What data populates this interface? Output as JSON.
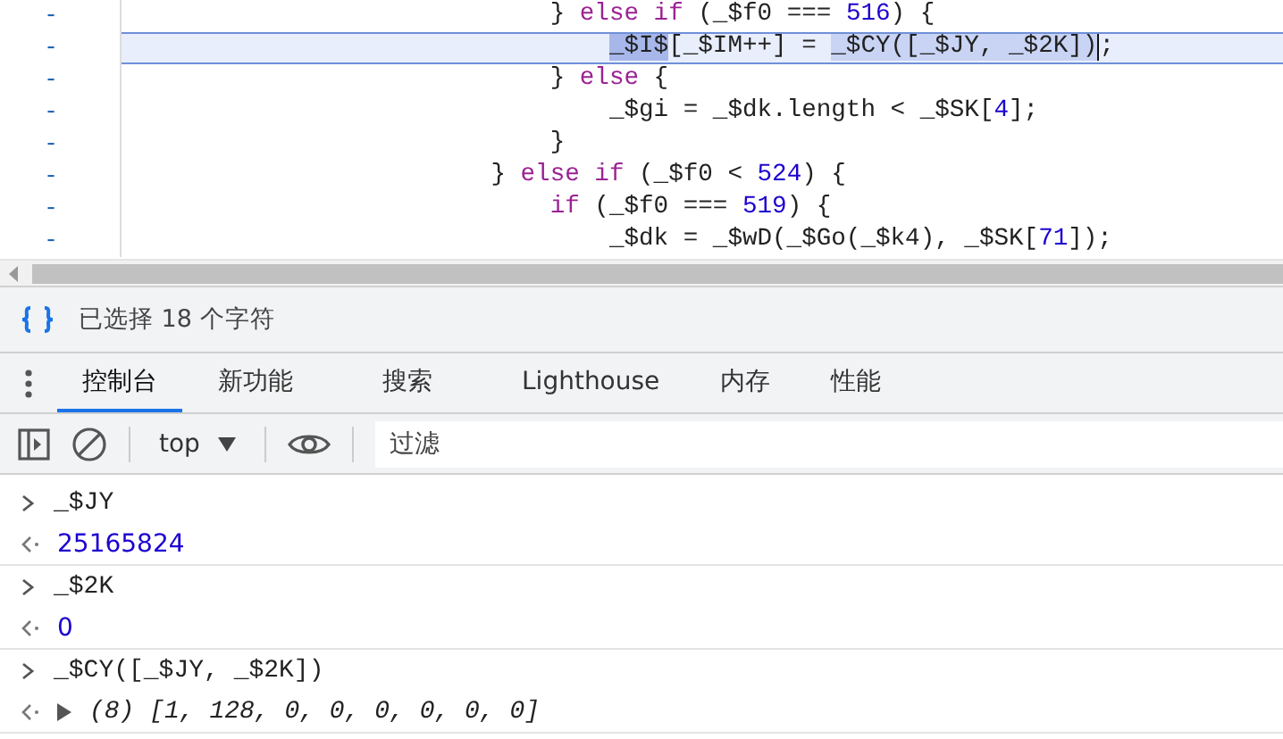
{
  "editor": {
    "lines": [
      {
        "children": [
          {
            "gutter": "-",
            "highlighted": false,
            "tokens": [
              {
                "kind": "plain",
                "text": "} "
              },
              {
                "kind": "keyword",
                "text": "else if"
              },
              {
                "kind": "plain",
                "text": " (_$f0 === "
              },
              {
                "kind": "number",
                "text": "516"
              },
              {
                "kind": "plain",
                "text": ") {"
              }
            ],
            "children": [
              {
                "gutter": "-",
                "highlighted": true,
                "tokens": [
                  {
                    "kind": "match",
                    "text": "_$I$"
                  },
                  {
                    "kind": "plain",
                    "text": "[_$IM++] = "
                  },
                  {
                    "kind": "selection",
                    "text": "_$CY([_$JY, _$2K])"
                  },
                  {
                    "kind": "plain",
                    "text": ";"
                  }
                ]
              }
            ]
          },
          {
            "gutter": "-",
            "highlighted": false,
            "tokens": [
              {
                "kind": "plain",
                "text": "} "
              },
              {
                "kind": "keyword",
                "text": "else"
              },
              {
                "kind": "plain",
                "text": " {"
              }
            ],
            "children": [
              {
                "gutter": "-",
                "highlighted": false,
                "tokens": [
                  {
                    "kind": "plain",
                    "text": "_$gi = _$dk.length < _$SK["
                  },
                  {
                    "kind": "number",
                    "text": "4"
                  },
                  {
                    "kind": "plain",
                    "text": "];"
                  }
                ]
              }
            ]
          },
          {
            "gutter": "-",
            "highlighted": false,
            "tokens": [
              {
                "kind": "plain",
                "text": "}"
              }
            ]
          }
        ]
      },
      {
        "gutter": "-",
        "highlighted": false,
        "tokens": [
          {
            "kind": "plain",
            "text": "} "
          },
          {
            "kind": "keyword",
            "text": "else if"
          },
          {
            "kind": "plain",
            "text": " (_$f0 < "
          },
          {
            "kind": "number",
            "text": "524"
          },
          {
            "kind": "plain",
            "text": ") {"
          }
        ],
        "children": [
          {
            "gutter": "-",
            "highlighted": false,
            "tokens": [
              {
                "kind": "keyword",
                "text": "if"
              },
              {
                "kind": "plain",
                "text": " (_$f0 === "
              },
              {
                "kind": "number",
                "text": "519"
              },
              {
                "kind": "plain",
                "text": ") {"
              }
            ],
            "children": [
              {
                "gutter": "-",
                "highlighted": false,
                "tokens": [
                  {
                    "kind": "plain",
                    "text": "_$dk = _$wD(_$Go(_$k4), _$SK["
                  },
                  {
                    "kind": "number",
                    "text": "71"
                  },
                  {
                    "kind": "plain",
                    "text": "]);"
                  }
                ]
              }
            ]
          }
        ]
      }
    ]
  },
  "status_bar": {
    "text": "已选择 18 个字符"
  },
  "tabs": [
    {
      "label": "控制台",
      "selected": true
    },
    {
      "label": "新功能",
      "selected": false
    },
    {
      "label": "搜索",
      "selected": false
    },
    {
      "label": "Lighthouse",
      "selected": false
    },
    {
      "label": "内存",
      "selected": false
    },
    {
      "label": "性能",
      "selected": false
    }
  ],
  "toolbar": {
    "context": "top",
    "filter": {
      "placeholder": "过滤"
    }
  },
  "console": [
    {
      "kind": "input",
      "text": "_$JY"
    },
    {
      "kind": "number",
      "text": "25165824"
    },
    {
      "kind": "input",
      "text": "_$2K"
    },
    {
      "kind": "number",
      "text": "0"
    },
    {
      "kind": "input",
      "text": "_$CY([_$JY, _$2K])"
    },
    {
      "kind": "array",
      "text": "(8) [1, 128, 0, 0, 0, 0, 0, 0]"
    }
  ]
}
